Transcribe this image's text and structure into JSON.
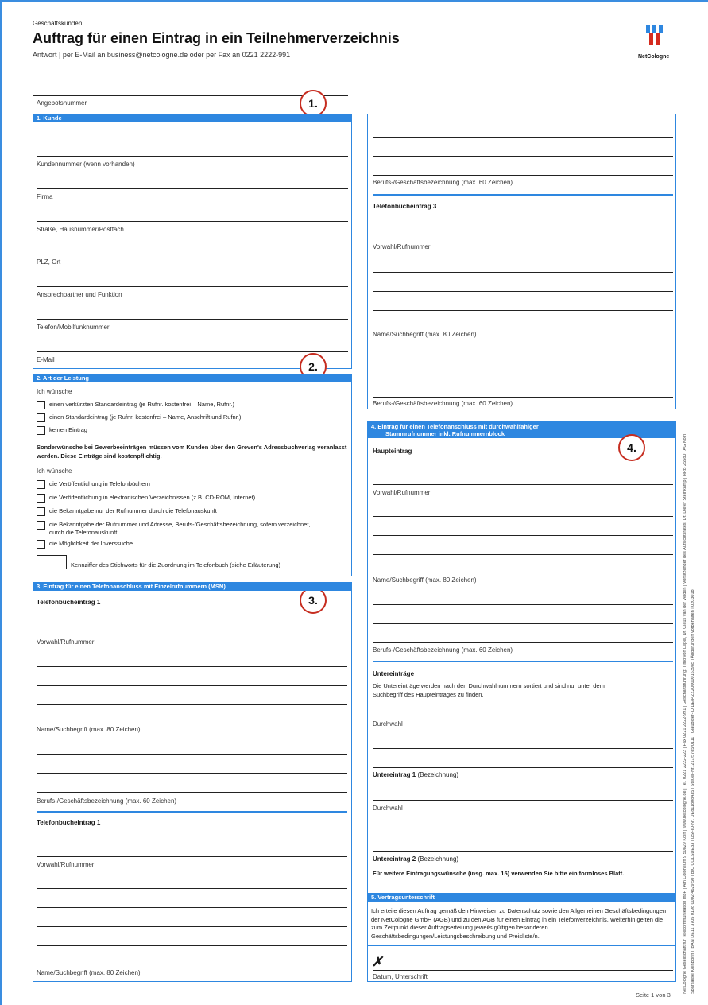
{
  "header": {
    "category": "Geschäftskunden",
    "title": "Auftrag für einen Eintrag in ein Teilnehmerverzeichnis",
    "subtitle": "Antwort | per E-Mail an business@netcologne.de oder per Fax an 0221 2222-991",
    "logo_text": "NetCologne"
  },
  "badges": [
    "1.",
    "2.",
    "3.",
    "4."
  ],
  "left": {
    "angebot_label": "Angebotsnummer",
    "section1": {
      "title": "1. Kunde",
      "fields": [
        "Kundennummer (wenn vorhanden)",
        "Firma",
        "Straße, Hausnummer/Postfach",
        "PLZ, Ort",
        "Ansprechpartner und Funktion",
        "Telefon/Mobilfunknummer",
        "E-Mail"
      ]
    },
    "section2": {
      "title": "2. Art der Leistung",
      "wish1": "Ich wünsche",
      "options1": [
        "einen verkürzten Standardeintrag (je Rufnr. kostenfrei – Name, Rufnr.)",
        "einen Standardeintrag (je Rufnr. kostenfrei – Name, Anschrift und Rufnr.)",
        "keinen Eintrag"
      ],
      "note": "Sonderwünsche bei Gewerbeeinträgen müssen vom Kunden über den Greven's Adressbuchverlag veranlasst werden. Diese Einträge sind kostenpflichtig.",
      "wish2": "Ich wünsche",
      "options2": [
        "die Veröffentlichung in Telefonbüchern",
        "die Veröffentlichung in elektronischen Verzeichnissen (z.B. CD-ROM, Internet)",
        "die Bekanntgabe nur der Rufnummer durch die Telefonauskunft",
        "die Bekanntgabe der Rufnummer und Adresse, Berufs-/Geschäftsbezeichnung, sofern verzeichnet, durch die Telefonauskunft",
        "die Möglichkeit der Inverssuche"
      ],
      "kennziffer": "Kennziffer des Stichworts für die Zuordnung im Telefonbuch (siehe Erläuterung)"
    },
    "section3": {
      "title": "3. Eintrag für einen Telefonanschluss mit Einzelrufnummern (MSN)",
      "entry1_title": "Telefonbucheintrag 1",
      "entry2_title": "Telefonbucheintrag 1",
      "vorwahl": "Vorwahl/Rufnummer",
      "name": "Name/Suchbegriff (max. 80 Zeichen)",
      "beruf": "Berufs-/Geschäftsbezeichnung (max. 60 Zeichen)"
    }
  },
  "right": {
    "beruf": "Berufs-/Geschäftsbezeichnung (max. 60 Zeichen)",
    "entry3_title": "Telefonbucheintrag 3",
    "vorwahl": "Vorwahl/Rufnummer",
    "name": "Name/Suchbegriff (max. 80 Zeichen)",
    "section4": {
      "title1": "4. Eintrag für einen Telefonanschluss mit durchwahlfähiger",
      "title2": "Stammrufnummer inkl. Rufnummernblock",
      "haupt": "Haupteintrag",
      "unter": "Untereinträge",
      "unter_note": "Die Untereinträge werden nach den Durchwahlnummern sortiert und sind nur unter dem Suchbegriff des Haupteintrages zu finden.",
      "durchwahl": "Durchwahl",
      "ue1": "Untereintrag 1",
      "ue2": "Untereintrag 2",
      "bez": "(Bezeichnung)",
      "footer": "Für weitere Eintragungswünsche (insg. max. 15) verwenden Sie bitte ein formloses Blatt."
    },
    "section5": {
      "title": "5. Vertragsunterschrift",
      "text": "Ich erteile diesen Auftrag gemäß den Hinweisen zu Datenschutz sowie den Allgemeinen Geschäftsbedingungen der NetCologne GmbH (AGB) und zu den AGB für einen Eintrag in ein Telefonverzeichnis. Weiterhin gelten die zum Zeitpunkt dieser Auftragserteilung jeweils gültigen besonderen Geschäftsbedingungen/Leistungsbeschreibung und Preisliste/n.",
      "mark": "✗",
      "datum": "Datum, Unterschrift"
    }
  },
  "footer": {
    "page": "Seite 1 von 3",
    "side1": "NetCologne Gesellschaft für Telekommunikation mbH | Am Coloneum 9 50829 Köln | www.netcologne.de | Tel. 0221 2222-222 | Fax 0221 2222-991 | Geschäftsführung: Timo von Lepel, Dr. Claus van der Velden | Vorsitzender des Aufsichtsrates: Dr. Dieter Steinkamp | HRB 25580 | AG Köln",
    "side2": "Sparkasse KölnBonn | IBAN DE11 3705 0198 0002 4629 50 | BIC COLSDE33 | USt-ID-Nr. DE811808435 | Steuer-Nr. 217/5785/0111 | Gläubiger-ID DE84ZZZ00000163985 | Änderungen vorbehalten | 020301b"
  }
}
